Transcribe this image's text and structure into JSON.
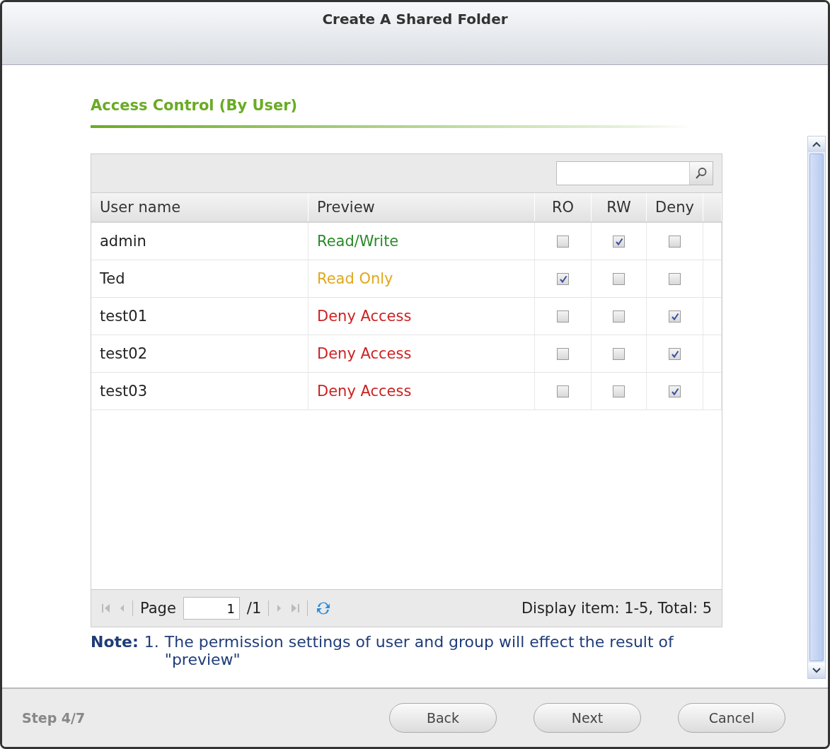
{
  "window": {
    "title": "Create A Shared Folder"
  },
  "section_title": "Access Control (By User)",
  "table": {
    "columns": [
      "User name",
      "Preview",
      "RO",
      "RW",
      "Deny"
    ],
    "rows": [
      {
        "user": "admin",
        "preview": "Read/Write",
        "color": "#2a8a2a",
        "ro": false,
        "rw": true,
        "deny": false
      },
      {
        "user": "Ted",
        "preview": "Read Only",
        "color": "#e0a81c",
        "ro": true,
        "rw": false,
        "deny": false
      },
      {
        "user": "test01",
        "preview": "Deny Access",
        "color": "#cc2222",
        "ro": false,
        "rw": false,
        "deny": true
      },
      {
        "user": "test02",
        "preview": "Deny Access",
        "color": "#cc2222",
        "ro": false,
        "rw": false,
        "deny": true
      },
      {
        "user": "test03",
        "preview": "Deny Access",
        "color": "#cc2222",
        "ro": false,
        "rw": false,
        "deny": true
      }
    ]
  },
  "pager": {
    "page_label": "Page",
    "page": "1",
    "total_pages": "/1",
    "display": "Display item: 1-5, Total: 5"
  },
  "note": {
    "label": "Note:",
    "number": "1.",
    "text": "The permission settings of user and group will effect the result of \"preview\""
  },
  "footer": {
    "step": "Step 4/7",
    "buttons": [
      "Back",
      "Next",
      "Cancel"
    ]
  }
}
